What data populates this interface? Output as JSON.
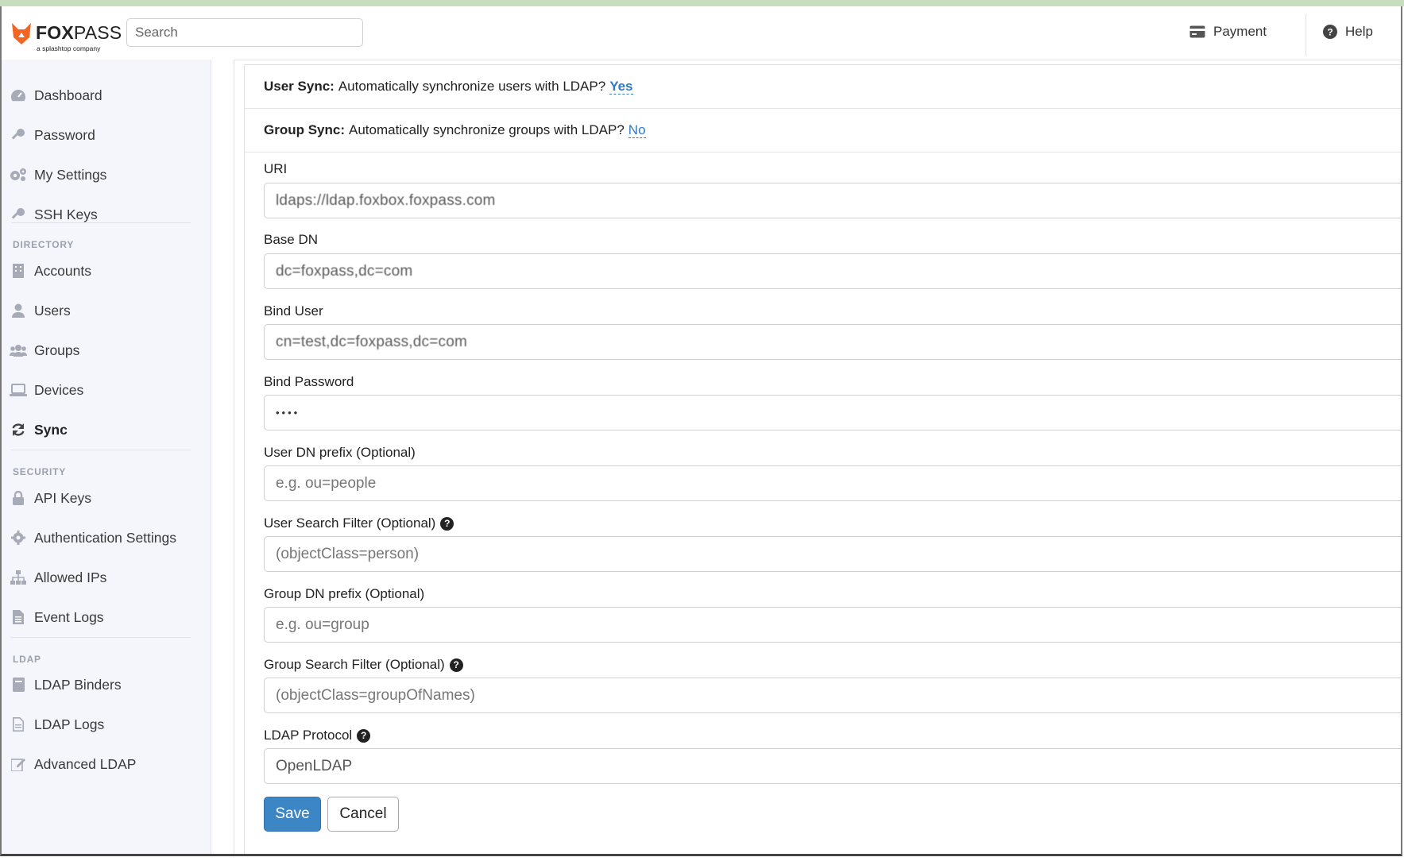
{
  "brand": {
    "name_bold": "FOX",
    "name_rest": "PASS",
    "tagline": "a splashtop company",
    "accent": "#f26522"
  },
  "header": {
    "search_placeholder": "Search",
    "payment_label": "Payment",
    "help_label": "Help"
  },
  "sidebar": {
    "items_top": [
      {
        "label": "Dashboard",
        "icon": "dashboard-icon"
      },
      {
        "label": "Password",
        "icon": "key-icon"
      },
      {
        "label": "My Settings",
        "icon": "gears-icon"
      },
      {
        "label": "SSH Keys",
        "icon": "key-icon"
      }
    ],
    "directory_label": "DIRECTORY",
    "items_directory": [
      {
        "label": "Accounts",
        "icon": "building-icon"
      },
      {
        "label": "Users",
        "icon": "user-icon"
      },
      {
        "label": "Groups",
        "icon": "users-icon"
      },
      {
        "label": "Devices",
        "icon": "laptop-icon"
      },
      {
        "label": "Sync",
        "icon": "sync-icon",
        "active": true
      }
    ],
    "security_label": "SECURITY",
    "items_security": [
      {
        "label": "API Keys",
        "icon": "lock-icon"
      },
      {
        "label": "Authentication Settings",
        "icon": "gear-icon"
      },
      {
        "label": "Allowed IPs",
        "icon": "sitemap-icon"
      },
      {
        "label": "Event Logs",
        "icon": "file-icon"
      }
    ],
    "ldap_label": "LDAP",
    "items_ldap": [
      {
        "label": "LDAP Binders",
        "icon": "book-icon"
      },
      {
        "label": "LDAP Logs",
        "icon": "file-icon"
      },
      {
        "label": "Advanced LDAP",
        "icon": "edit-icon"
      }
    ]
  },
  "sync": {
    "user_sync_label": "User Sync:",
    "user_sync_question": "Automatically synchronize users with LDAP?",
    "user_sync_value": "Yes",
    "group_sync_label": "Group Sync:",
    "group_sync_question": "Automatically synchronize groups with LDAP?",
    "group_sync_value": "No"
  },
  "form": {
    "uri_label": "URI",
    "uri_value": "ldaps://ldap.foxbox.foxpass.com",
    "base_dn_label": "Base DN",
    "base_dn_value": "dc=foxpass,dc=com",
    "bind_user_label": "Bind User",
    "bind_user_value": "cn=test,dc=foxpass,dc=com",
    "bind_password_label": "Bind Password",
    "bind_password_value": "••••",
    "user_dn_prefix_label": "User DN prefix (Optional)",
    "user_dn_prefix_placeholder": "e.g. ou=people",
    "user_search_filter_label": "User Search Filter (Optional)",
    "user_search_filter_placeholder": "(objectClass=person)",
    "group_dn_prefix_label": "Group DN prefix (Optional)",
    "group_dn_prefix_placeholder": "e.g. ou=group",
    "group_search_filter_label": "Group Search Filter (Optional)",
    "group_search_filter_placeholder": "(objectClass=groupOfNames)",
    "ldap_protocol_label": "LDAP Protocol",
    "ldap_protocol_value": "OpenLDAP",
    "help_glyph": "?",
    "save_label": "Save",
    "cancel_label": "Cancel"
  }
}
